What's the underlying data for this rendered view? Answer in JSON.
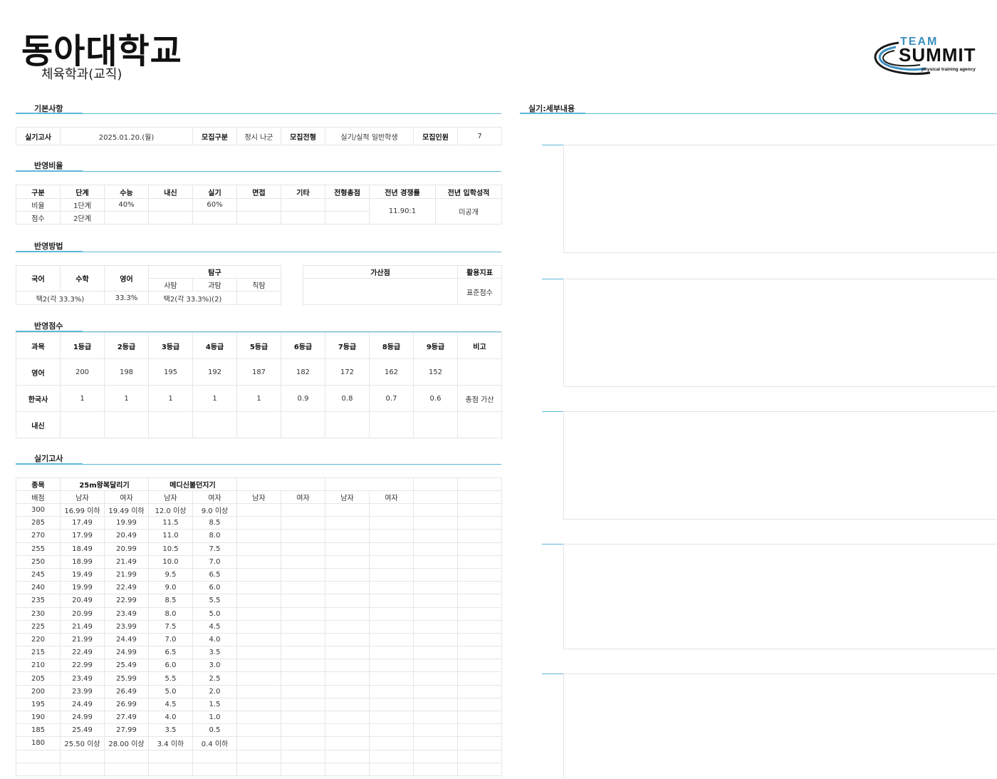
{
  "header": {
    "school": "동아대학교",
    "department": "체육학과(교직)",
    "logo": {
      "line1": "TEAM",
      "line2": "SUMMIT",
      "line3": "physical training agency"
    }
  },
  "sections": {
    "basic": "기본사항",
    "ratio": "반영비율",
    "method": "반영방법",
    "score": "반영점수",
    "practical": "실기고사",
    "detail": "실기:세부내용"
  },
  "basic": {
    "exam_label": "실기고사",
    "exam_value": "2025.01.20.(월)",
    "type_label": "모집구분",
    "type_value": "정시 나군",
    "track_label": "모집전형",
    "track_value": "실기/실적 일반학생",
    "count_label": "모집인원",
    "count_value": "7"
  },
  "ratio": {
    "headers": [
      "구분",
      "단계",
      "수능",
      "내신",
      "실기",
      "면접",
      "기타",
      "전형총점",
      "전년 경쟁률",
      "전년 입학성적"
    ],
    "row1": [
      "비율",
      "1단계",
      "40%",
      "",
      "60%",
      "",
      "",
      ""
    ],
    "row2": [
      "점수",
      "2단계",
      "",
      "",
      "",
      "",
      "",
      ""
    ],
    "competition": "11.90:1",
    "last_score": "미공개"
  },
  "method": {
    "korean": "국어",
    "math": "수학",
    "english": "영어",
    "inquiry": "탐구",
    "social": "사탐",
    "science": "과탐",
    "vocational": "직탐",
    "korean_math_value": "택2(각 33.3%)",
    "english_value": "33.3%",
    "inquiry_value": "택2(각 33.3%)(2)",
    "bonus_label": "가산점",
    "bonus_value": "",
    "index_label": "활용지표",
    "index_value": "표준점수"
  },
  "score": {
    "headers": [
      "과목",
      "1등급",
      "2등급",
      "3등급",
      "4등급",
      "5등급",
      "6등급",
      "7등급",
      "8등급",
      "9등급",
      "비고"
    ],
    "rows": [
      [
        "영어",
        "200",
        "198",
        "195",
        "192",
        "187",
        "182",
        "172",
        "162",
        "152",
        ""
      ],
      [
        "한국사",
        "1",
        "1",
        "1",
        "1",
        "1",
        "0.9",
        "0.8",
        "0.7",
        "0.6",
        "총점 가산"
      ],
      [
        "내신",
        "",
        "",
        "",
        "",
        "",
        "",
        "",
        "",
        "",
        ""
      ]
    ]
  },
  "practical": {
    "event_label": "종목",
    "events": [
      "25m왕복달리기",
      "메디신볼던지기",
      "",
      ""
    ],
    "score_label": "배점",
    "genders": [
      "남자",
      "여자",
      "남자",
      "여자",
      "남자",
      "여자",
      "남자",
      "여자"
    ],
    "rows": [
      [
        "300",
        "16.99 이하",
        "19.49 이하",
        "12.0 이상",
        "9.0 이상"
      ],
      [
        "285",
        "17.49",
        "19.99",
        "11.5",
        "8.5"
      ],
      [
        "270",
        "17.99",
        "20.49",
        "11.0",
        "8.0"
      ],
      [
        "255",
        "18.49",
        "20.99",
        "10.5",
        "7.5"
      ],
      [
        "250",
        "18.99",
        "21.49",
        "10.0",
        "7.0"
      ],
      [
        "245",
        "19.49",
        "21.99",
        "9.5",
        "6.5"
      ],
      [
        "240",
        "19.99",
        "22.49",
        "9.0",
        "6.0"
      ],
      [
        "235",
        "20.49",
        "22.99",
        "8.5",
        "5.5"
      ],
      [
        "230",
        "20.99",
        "23.49",
        "8.0",
        "5.0"
      ],
      [
        "225",
        "21.49",
        "23.99",
        "7.5",
        "4.5"
      ],
      [
        "220",
        "21.99",
        "24.49",
        "7.0",
        "4.0"
      ],
      [
        "215",
        "22.49",
        "24.99",
        "6.5",
        "3.5"
      ],
      [
        "210",
        "22.99",
        "25.49",
        "6.0",
        "3.0"
      ],
      [
        "205",
        "23.49",
        "25.99",
        "5.5",
        "2.5"
      ],
      [
        "200",
        "23.99",
        "26.49",
        "5.0",
        "2.0"
      ],
      [
        "195",
        "24.49",
        "26.99",
        "4.5",
        "1.5"
      ],
      [
        "190",
        "24.99",
        "27.49",
        "4.0",
        "1.0"
      ],
      [
        "185",
        "25.49",
        "27.99",
        "3.5",
        "0.5"
      ],
      [
        "180",
        "25.50 이상",
        "28.00 이상",
        "3.4 이하",
        "0.4 이하"
      ],
      [
        "",
        "",
        "",
        "",
        ""
      ],
      [
        "",
        "",
        "",
        "",
        ""
      ]
    ]
  },
  "colors": {
    "accent": "#5bb8d8"
  }
}
